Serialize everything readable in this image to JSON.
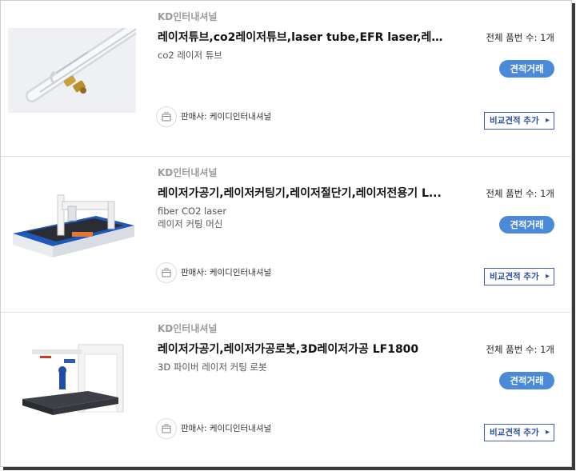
{
  "products": [
    {
      "company": "KD인터내셔널",
      "title": "레이저튜브,co2레이저튜브,laser tube,EFR laser,레이저...",
      "desc_lines": [
        "co2 레이저 튜브"
      ],
      "seller": "판매사: 케이디인터내셔널",
      "count": "전체 품번 수: 1개",
      "quote_label": "견적거래",
      "compare_label": "비교견적 추가",
      "image": "laser-tube"
    },
    {
      "company": "KD인터내셔널",
      "title": "레이저가공기,레이저커팅기,레이저절단기,레이저전용기 L...",
      "desc_lines": [
        "fiber CO2 laser",
        "레이저 커팅 머신"
      ],
      "seller": "판매사: 케이디인터내셔널",
      "count": "전체 품번 수: 1개",
      "quote_label": "견적거래",
      "compare_label": "비교견적 추가",
      "image": "laser-cutting-machine"
    },
    {
      "company": "KD인터내셔널",
      "title": "레이저가공기,레이저가공로봇,3D레이저가공 LF1800",
      "desc_lines": [
        "3D 파이버 레이저 커팅 로봇"
      ],
      "seller": "판매사: 케이디인터내셔널",
      "count": "전체 품번 수: 1개",
      "quote_label": "견적거래",
      "compare_label": "비교견적 추가",
      "image": "laser-robot"
    }
  ],
  "colors": {
    "accent": "#4a8ad8",
    "compare_border": "#3c62b8",
    "company": "#9a9a9a"
  },
  "icons": {
    "seller": "store-icon",
    "compare_arrow": "chevron-right-icon"
  }
}
